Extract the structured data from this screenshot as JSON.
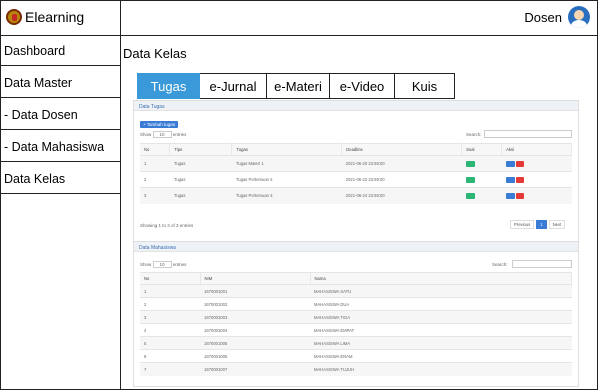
{
  "app": {
    "title": "Elearning",
    "role": "Dosen"
  },
  "sidebar": {
    "items": [
      {
        "label": "Dashboard"
      },
      {
        "label": "Data Master"
      },
      {
        "label": "- Data Dosen"
      },
      {
        "label": "- Data Mahasiswa"
      },
      {
        "label": "Data Kelas"
      }
    ]
  },
  "main": {
    "title": "Data Kelas",
    "tabs": [
      {
        "label": "Tugas",
        "active": true
      },
      {
        "label": "e-Jurnal"
      },
      {
        "label": "e-Materi"
      },
      {
        "label": "e-Video"
      },
      {
        "label": "Kuis"
      }
    ]
  },
  "tugas": {
    "heading": "Data Tugas",
    "add_label": "+ Tambah tugas",
    "show_label": "Show",
    "show_value": "10",
    "entries_label": "entries",
    "search_label": "Search:",
    "columns": [
      "No",
      "Tipe",
      "Tugas",
      "Deadline",
      "Soal",
      "Aksi"
    ],
    "rows": [
      {
        "no": "1",
        "tipe": "Tugas",
        "tugas": "Tugas Materi 1",
        "deadline": "2021-06-20 23:59:00"
      },
      {
        "no": "2",
        "tipe": "Tugas",
        "tugas": "Tugas Pertemuan 2",
        "deadline": "2021-06-22 23:59:00"
      },
      {
        "no": "3",
        "tipe": "Tugas",
        "tugas": "Tugas Pertemuan 3",
        "deadline": "2021-06-24 23:59:00"
      }
    ],
    "info": "Showing 1 to 3 of 3 entries",
    "pager": {
      "prev": "Previous",
      "page": "1",
      "next": "Next"
    }
  },
  "mahasiswa": {
    "heading": "Data Mahasiswa",
    "show_label": "Show",
    "show_value": "10",
    "entries_label": "entries",
    "search_label": "Search:",
    "columns": [
      "No",
      "NIM",
      "Nama"
    ],
    "rows": [
      {
        "no": "1",
        "nim": "1670001001",
        "nama": "MAHASISWA SATU"
      },
      {
        "no": "2",
        "nim": "1670001002",
        "nama": "MAHASISWA DUA"
      },
      {
        "no": "3",
        "nim": "1670001003",
        "nama": "MAHASISWA TIGA"
      },
      {
        "no": "4",
        "nim": "1670001004",
        "nama": "MAHASISWA EMPAT"
      },
      {
        "no": "5",
        "nim": "1670001005",
        "nama": "MAHASISWA LIMA"
      },
      {
        "no": "6",
        "nim": "1670001006",
        "nama": "MAHASISWA ENAM"
      },
      {
        "no": "7",
        "nim": "1670001007",
        "nama": "MAHASISWA TUJUH"
      }
    ]
  }
}
